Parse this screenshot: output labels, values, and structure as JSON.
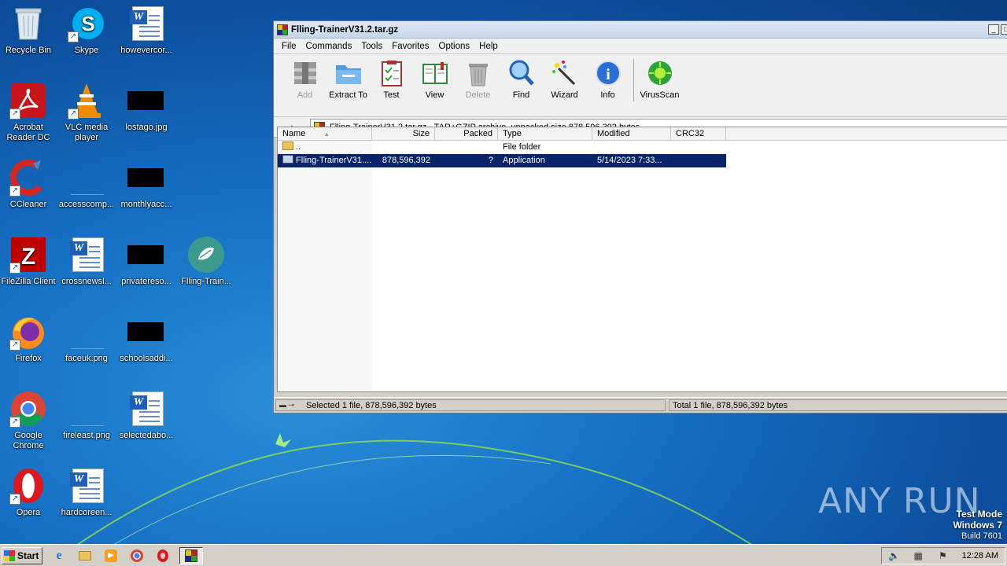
{
  "desktop": {
    "icons": [
      {
        "label": "Recycle Bin"
      },
      {
        "label": "Skype"
      },
      {
        "label": "howevercor..."
      },
      {
        "label": "Acrobat Reader DC"
      },
      {
        "label": "VLC media player"
      },
      {
        "label": "lostago.jpg"
      },
      {
        "label": "CCleaner"
      },
      {
        "label": "accesscomp..."
      },
      {
        "label": "monthlyacc..."
      },
      {
        "label": "FileZilla Client"
      },
      {
        "label": "crossnewsl..."
      },
      {
        "label": "privatereso..."
      },
      {
        "label": "Flling-Train..."
      },
      {
        "label": "Firefox"
      },
      {
        "label": "faceuk.png"
      },
      {
        "label": "schoolsaddi..."
      },
      {
        "label": "Google Chrome"
      },
      {
        "label": "fireleast.png"
      },
      {
        "label": "selectedabo..."
      },
      {
        "label": "Opera"
      },
      {
        "label": "hardcoreen..."
      }
    ]
  },
  "window": {
    "title": "Flling-TrainerV31.2.tar.gz",
    "menu": [
      "File",
      "Commands",
      "Tools",
      "Favorites",
      "Options",
      "Help"
    ],
    "toolbar": [
      {
        "label": "Add",
        "icon": "add-icon",
        "disabled": true
      },
      {
        "label": "Extract To",
        "icon": "extract-folder-icon",
        "disabled": false
      },
      {
        "label": "Test",
        "icon": "test-clipboard-icon",
        "disabled": false
      },
      {
        "label": "View",
        "icon": "view-book-icon",
        "disabled": false
      },
      {
        "label": "Delete",
        "icon": "trash-icon",
        "disabled": true
      },
      {
        "label": "Find",
        "icon": "magnifier-icon",
        "disabled": false
      },
      {
        "label": "Wizard",
        "icon": "wand-icon",
        "disabled": false
      },
      {
        "label": "Info",
        "icon": "info-icon",
        "disabled": false
      },
      {
        "label": "VirusScan",
        "icon": "virus-icon",
        "disabled": false
      }
    ],
    "address": "Flling-TrainerV31.2.tar.gz - TAR+GZIP archive, unpacked size 878,596,392 bytes",
    "columns": {
      "name": "Name",
      "size": "Size",
      "packed": "Packed",
      "type": "Type",
      "modified": "Modified",
      "crc": "CRC32"
    },
    "rows": [
      {
        "name": "..",
        "size": "",
        "packed": "",
        "type": "File folder",
        "modified": "",
        "crc": ""
      },
      {
        "name": "Flling-TrainerV31....",
        "size": "878,596,392",
        "packed": "?",
        "type": "Application",
        "modified": "5/14/2023 7:33...",
        "crc": ""
      }
    ],
    "status_left": "Selected 1 file, 878,596,392 bytes",
    "status_right": "Total 1 file, 878,596,392 bytes"
  },
  "taskbar": {
    "start": "Start",
    "clock": "12:28 AM"
  },
  "watermark": {
    "line1": "Test Mode",
    "line2": "Windows 7",
    "line3": "Build 7601",
    "brand": "ANY RUN"
  },
  "colors": {
    "selection": "#0a246a",
    "window_bg": "#d4d0c8",
    "desktop": "#1670c4"
  }
}
